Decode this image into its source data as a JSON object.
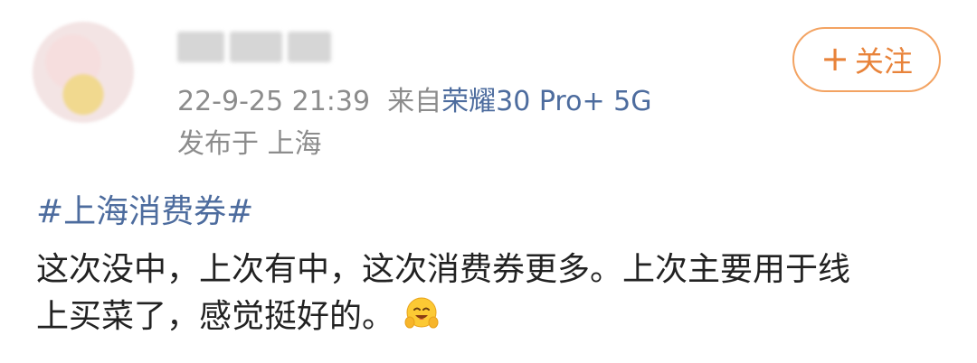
{
  "post": {
    "timestamp": "22-9-25 21:39",
    "from_prefix": "来自",
    "device": "荣耀30 Pro+ 5G",
    "location": "发布于 上海",
    "follow_icon": "+",
    "follow_label": "关注",
    "hashtag": "#上海消费券#",
    "body_line1": "这次没中，上次有中，这次消费券更多。上次主要用于线",
    "body_line2": "上买菜了，感觉挺好的。",
    "emoji": "smiling-face-with-open-hands-emoji"
  },
  "colors": {
    "link_blue": "#4d6c9e",
    "follow_orange": "#e8833a",
    "follow_border": "#f3a362",
    "meta_gray": "#8c8c8c",
    "text": "#222222"
  }
}
